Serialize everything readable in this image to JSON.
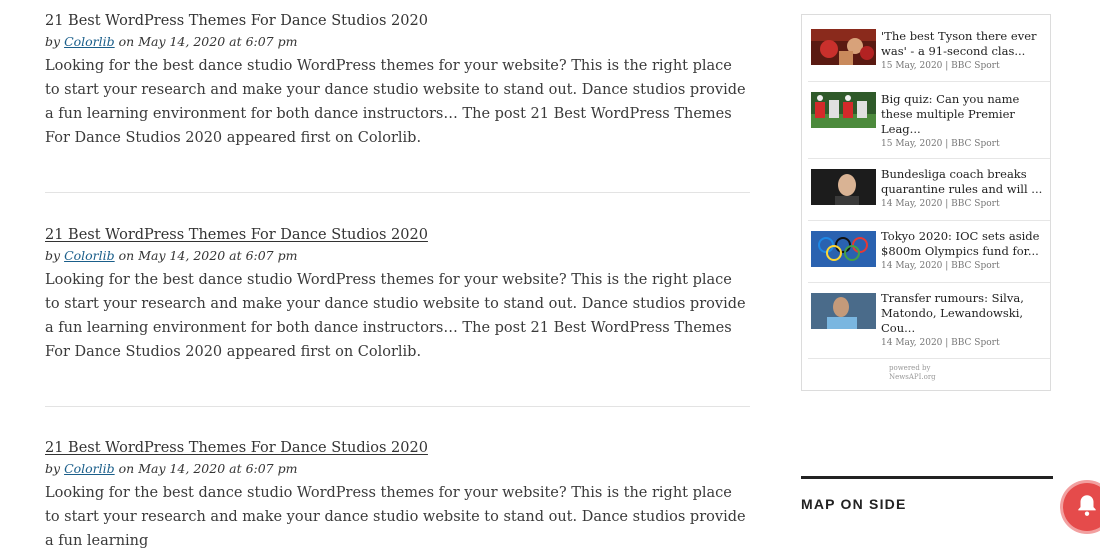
{
  "posts": [
    {
      "title": "21 Best WordPress Themes For Dance Studios 2020",
      "by": "by",
      "author": "Colorlib",
      "date": "on May 14, 2020 at 6:07 pm",
      "excerpt": "Looking for the best dance studio WordPress themes for your website? This is the right place to start your research and make your dance studio website to stand out. Dance studios provide a fun learning environment for both dance instructors… The post 21 Best WordPress Themes For Dance Studios 2020 appeared first on Colorlib."
    },
    {
      "title": "21 Best WordPress Themes For Dance Studios 2020",
      "by": "by",
      "author": "Colorlib",
      "date": "on May 14, 2020 at 6:07 pm",
      "excerpt": "Looking for the best dance studio WordPress themes for your website? This is the right place to start your research and make your dance studio website to stand out. Dance studios provide a fun learning environment for both dance instructors… The post 21 Best WordPress Themes For Dance Studios 2020 appeared first on Colorlib."
    },
    {
      "title": "21 Best WordPress Themes For Dance Studios 2020",
      "by": "by",
      "author": "Colorlib",
      "date": "on May 14, 2020 at 6:07 pm",
      "excerpt": "Looking for the best dance studio WordPress themes for your website? This is the right place to start your research and make your dance studio website to stand out. Dance studios provide a fun learning"
    }
  ],
  "news": [
    {
      "title": "'The best Tyson there ever was' - a 91-second clas...",
      "meta": "15 May, 2020 | BBC Sport",
      "thumb": "boxing-photo"
    },
    {
      "title": "Big quiz: Can you name these multiple Premier Leag...",
      "meta": "15 May, 2020 | BBC Sport",
      "thumb": "football-team-photo"
    },
    {
      "title": "Bundesliga coach breaks quarantine rules and will ...",
      "meta": "14 May, 2020 | BBC Sport",
      "thumb": "coach-portrait-photo"
    },
    {
      "title": "Tokyo 2020: IOC sets aside $800m Olympics fund for...",
      "meta": "14 May, 2020 | BBC Sport",
      "thumb": "olympic-rings-photo"
    },
    {
      "title": "Transfer rumours: Silva, Matondo, Lewandowski, Cou...",
      "meta": "14 May, 2020 | BBC Sport",
      "thumb": "footballer-photo"
    }
  ],
  "powered_by": {
    "line1": "powered by",
    "line2": "NewsAPI.org"
  },
  "sidebar": {
    "map_title": "MAP ON SIDE"
  },
  "notification": {
    "icon": "bell-icon",
    "color": "#e54b4b"
  }
}
